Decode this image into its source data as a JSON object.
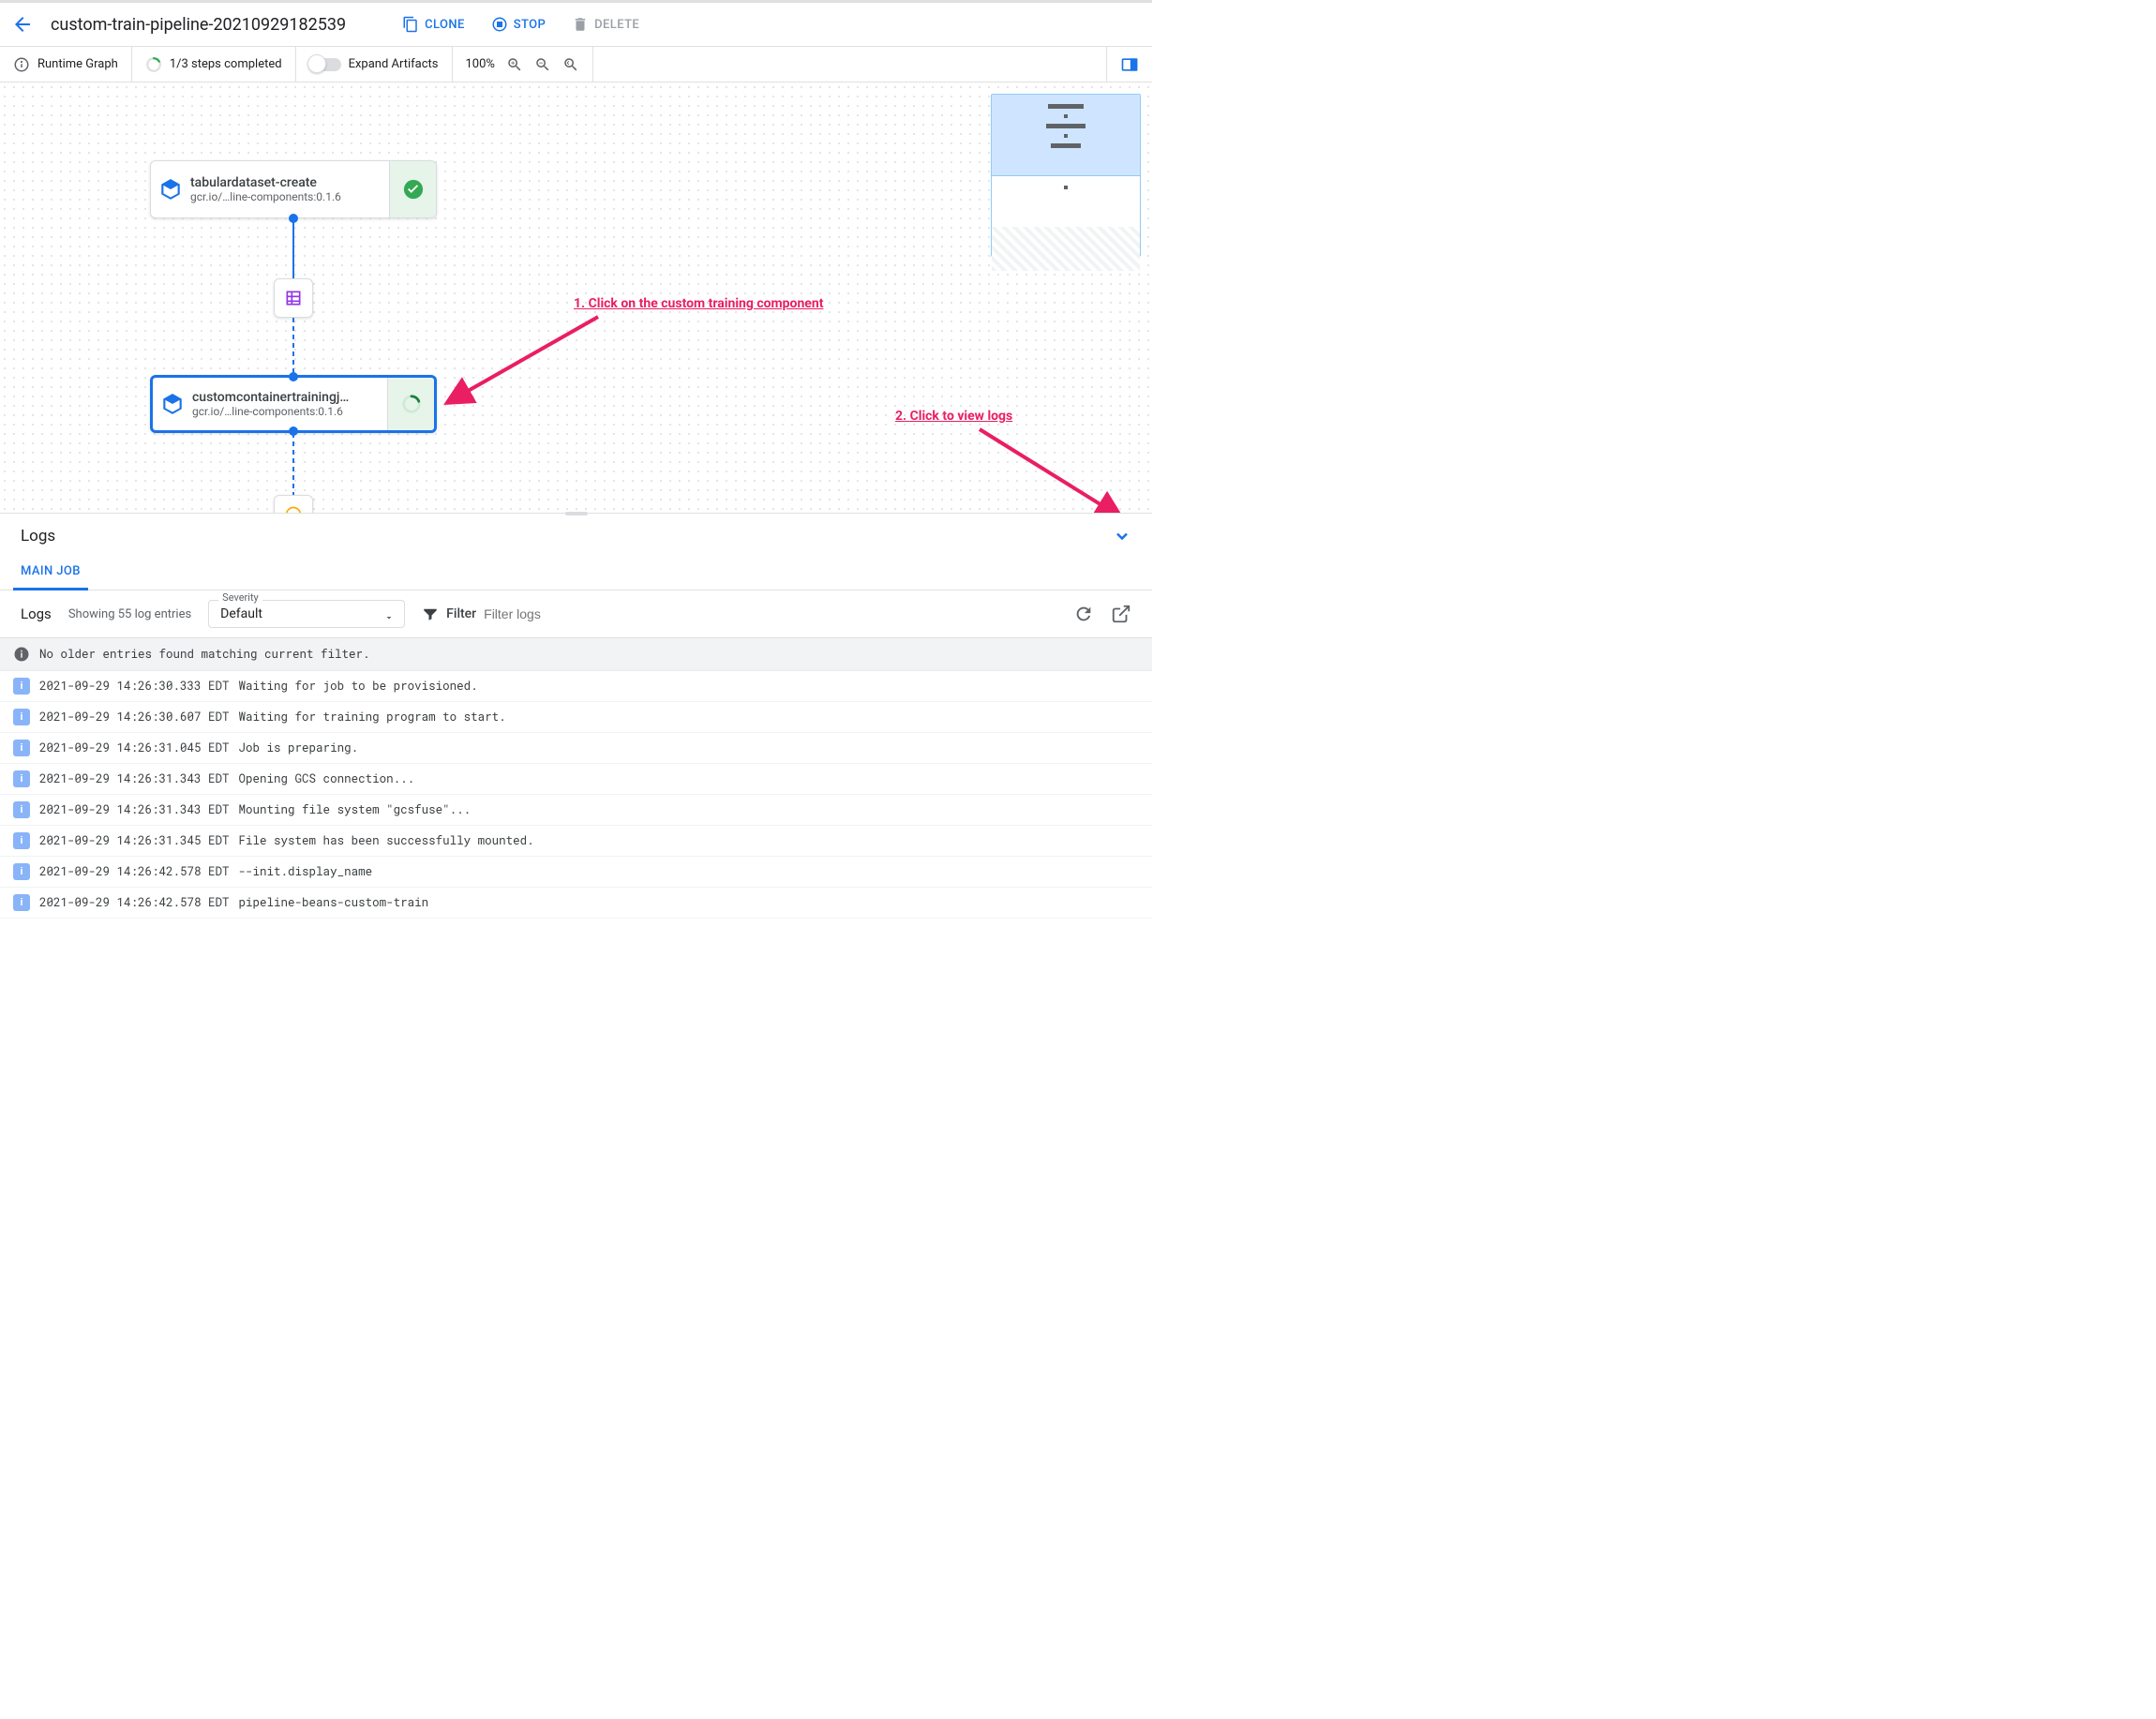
{
  "header": {
    "title": "custom-train-pipeline-20210929182539",
    "clone": "Clone",
    "stop": "Stop",
    "delete": "Delete"
  },
  "subtoolbar": {
    "runtime_graph": "Runtime Graph",
    "steps_completed": "1/3 steps completed",
    "expand_artifacts": "Expand Artifacts",
    "zoom": "100%"
  },
  "nodes": {
    "n1": {
      "title": "tabulardataset-create",
      "sub": "gcr.io/…line-components:0.1.6"
    },
    "n2": {
      "title": "customcontainertrainingj…",
      "sub": "gcr.io/…line-components:0.1.6"
    }
  },
  "annotations": {
    "a1": "1. Click on the custom training component",
    "a2": "2. Click to view logs"
  },
  "logs": {
    "title": "Logs",
    "tab_main": "MAIN JOB",
    "subtitle": "Logs",
    "count": "Showing 55 log entries",
    "severity_label": "Severity",
    "severity_value": "Default",
    "filter_label": "Filter",
    "filter_placeholder": "Filter logs",
    "banner": "No older entries found matching current filter.",
    "entries": [
      {
        "ts": "2021-09-29 14:26:30.333 EDT",
        "msg": "Waiting for job to be provisioned."
      },
      {
        "ts": "2021-09-29 14:26:30.607 EDT",
        "msg": "Waiting for training program to start."
      },
      {
        "ts": "2021-09-29 14:26:31.045 EDT",
        "msg": "Job is preparing."
      },
      {
        "ts": "2021-09-29 14:26:31.343 EDT",
        "msg": "Opening GCS connection..."
      },
      {
        "ts": "2021-09-29 14:26:31.343 EDT",
        "msg": "Mounting file system \"gcsfuse\"..."
      },
      {
        "ts": "2021-09-29 14:26:31.345 EDT",
        "msg": "File system has been successfully mounted."
      },
      {
        "ts": "2021-09-29 14:26:42.578 EDT",
        "msg": "--init.display_name"
      },
      {
        "ts": "2021-09-29 14:26:42.578 EDT",
        "msg": "pipeline-beans-custom-train"
      }
    ]
  }
}
